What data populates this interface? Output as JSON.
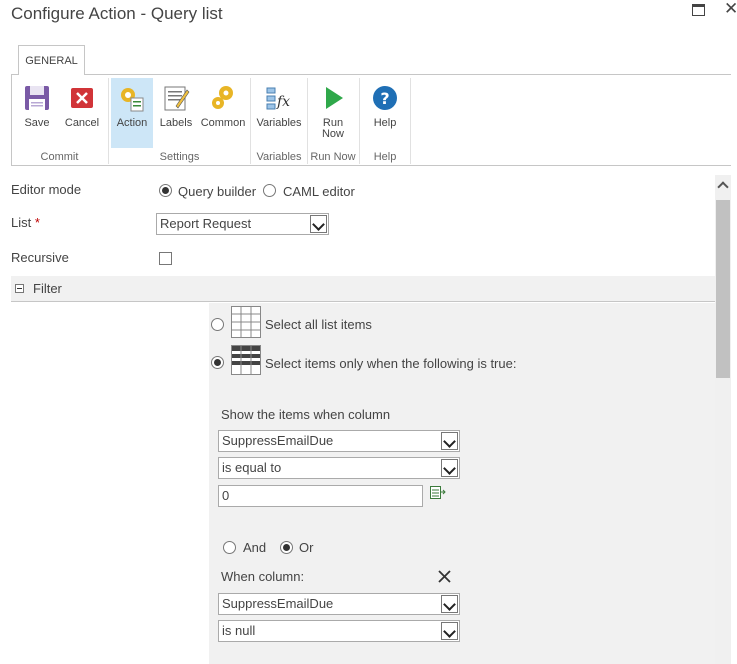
{
  "window": {
    "title": "Configure Action - Query list"
  },
  "ribbon": {
    "tab": "GENERAL",
    "buttons": {
      "save": "Save",
      "cancel": "Cancel",
      "action": "Action",
      "labels": "Labels",
      "common": "Common",
      "variables": "Variables",
      "run_now": "Run Now",
      "help": "Help"
    },
    "groups": {
      "commit": "Commit",
      "settings": "Settings",
      "variables": "Variables",
      "run_now": "Run Now",
      "help": "Help"
    },
    "icons": [
      "floppy-disk-icon",
      "cancel-x-icon",
      "gear-action-icon",
      "labels-icon",
      "gears-common-icon",
      "fx-variables-icon",
      "play-run-icon",
      "question-help-icon"
    ]
  },
  "form": {
    "editor_mode": {
      "label": "Editor mode",
      "options": [
        "Query builder",
        "CAML editor"
      ],
      "selected": "Query builder"
    },
    "list": {
      "label": "List",
      "required_marker": "*",
      "value": "Report Request"
    },
    "recursive": {
      "label": "Recursive",
      "checked": false
    }
  },
  "filter": {
    "title": "Filter",
    "option_all": "Select all list items",
    "option_conditional": "Select items only when the following is true:",
    "selected_option": "conditional",
    "show_items_label": "Show the items when column",
    "condition1": {
      "column": "SuppressEmailDue",
      "operator": "is equal to",
      "value": "0"
    },
    "logic": {
      "options": [
        "And",
        "Or"
      ],
      "selected": "Or"
    },
    "when_column_label": "When column:",
    "condition2": {
      "column": "SuppressEmailDue",
      "operator": "is null"
    }
  },
  "colors": {
    "accent": "#0072c6",
    "selected_button_bg": "#cde6f7",
    "required": "#bf0000",
    "section_bg": "#f1f1f1"
  }
}
